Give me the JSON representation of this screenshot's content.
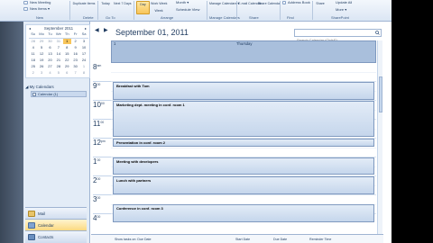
{
  "ribbon": {
    "new_meeting": "New Meeting",
    "new_items": "New Items ▾",
    "new_group": "New",
    "delete_group": "Delete",
    "today": "Today",
    "next7days": "Next 7 Days",
    "goto_group": "Go To",
    "day": "Day",
    "work_week": "Work Week",
    "week": "Week",
    "month": "Month ▾",
    "schedule_view": "Schedule View",
    "arrange_group": "Arrange",
    "manage_calendars": "Manage Calendars ▾",
    "manage_group": "Manage Calendars",
    "email_calendar": "E-mail Calendar",
    "share_calendar": "Share Calendar",
    "share_group": "Share",
    "address_book": "Address Book",
    "find_group": "Find",
    "share_btn": "Share",
    "update_all": "Update All",
    "more": "More ▾",
    "sharepoint_group": "SharePoint",
    "duplicate_items": "Duplicate Items"
  },
  "mini_calendar": {
    "title": "September 2011",
    "prev_arrow": "◂",
    "next_arrow": "▸",
    "weekdays": [
      "Su",
      "Mo",
      "Tu",
      "We",
      "Th",
      "Fr",
      "Sa"
    ],
    "weeks": [
      [
        "28",
        "29",
        "30",
        "31",
        "1",
        "2",
        "3"
      ],
      [
        "4",
        "5",
        "6",
        "7",
        "8",
        "9",
        "10"
      ],
      [
        "11",
        "12",
        "13",
        "14",
        "15",
        "16",
        "17"
      ],
      [
        "18",
        "19",
        "20",
        "21",
        "22",
        "23",
        "24"
      ],
      [
        "25",
        "26",
        "27",
        "28",
        "29",
        "30",
        "1"
      ],
      [
        "2",
        "3",
        "4",
        "5",
        "6",
        "7",
        "8"
      ]
    ]
  },
  "calendars": {
    "header": "◢ My Calendars",
    "item": "Calendar (1)"
  },
  "nav_buttons": {
    "mail": "Mail",
    "calendar": "Calendar",
    "contacts": "Contacts"
  },
  "main": {
    "prev": "◀",
    "next": "▶",
    "date_title": "September 01, 2011",
    "search_placeholder": "Search Calendar (Ctrl+E)",
    "day_number": "1",
    "day_name": "Thursday",
    "times": [
      {
        "h": "8",
        "m": "am"
      },
      {
        "h": "9",
        "m": "00"
      },
      {
        "h": "10",
        "m": "00"
      },
      {
        "h": "11",
        "m": "00"
      },
      {
        "h": "12",
        "m": "pm"
      },
      {
        "h": "1",
        "m": "00"
      },
      {
        "h": "2",
        "m": "00"
      },
      {
        "h": "3",
        "m": "00"
      },
      {
        "h": "4",
        "m": "00"
      }
    ],
    "appointments": [
      "Breakfast with Tom",
      "Marketing dept. meeting in conf. room 1",
      "Presentation in conf. room 2",
      "Meeting with developers",
      "Lunch with partners",
      "Conference in conf. room 3"
    ]
  },
  "tasks": {
    "col1": "Show tasks on: Due Date",
    "col2": "Start Date",
    "col3": "Due Date",
    "col4": "Reminder Time"
  },
  "colors": {
    "accent": "#f8c55a",
    "header_blue": "#a9bfdc",
    "appt_border": "#7f99bf"
  }
}
